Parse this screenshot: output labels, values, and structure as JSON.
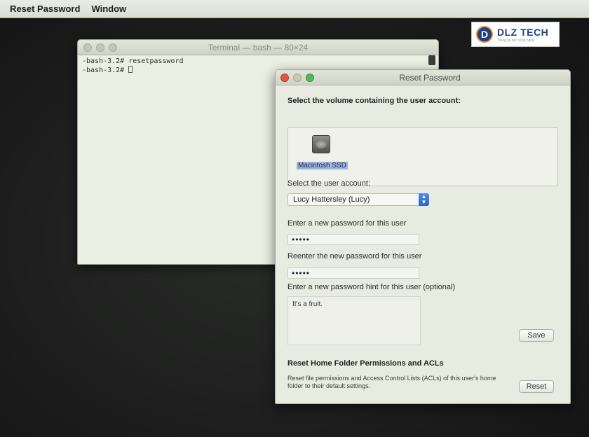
{
  "menubar": {
    "app_name": "Reset Password",
    "window_menu": "Window"
  },
  "terminal": {
    "title": "Terminal — bash — 80×24",
    "lines": [
      "-bash-3.2# resetpassword",
      "-bash-3.2# "
    ]
  },
  "reset_window": {
    "title": "Reset Password",
    "volume_heading": "Select the volume containing the user account:",
    "volume_name": "Macintosh SSD",
    "user_label": "Select the user account:",
    "selected_user": "Lucy Hattersley (Lucy)",
    "new_password_label": "Enter a new password for this user",
    "new_password_value": "•••••",
    "reenter_label": "Reenter the new password for this user",
    "reenter_value": "•••••",
    "hint_label": "Enter a new password hint for this user (optional)",
    "hint_value": "It's a fruit.",
    "save_label": "Save",
    "acl_heading": "Reset Home Folder Permissions and ACLs",
    "acl_description": "Reset file permissions and Access Control Lists (ACLs) of this user's home folder to their default settings.",
    "reset_label": "Reset"
  },
  "logo": {
    "mark": "D",
    "name": "DLZ TECH",
    "tagline": "Trang tin tức công nghệ"
  },
  "colors": {
    "selection": "#9db3dd",
    "popup_accent": "#2a65c5",
    "close_button": "#e0554a",
    "zoom_button": "#57b75a"
  }
}
